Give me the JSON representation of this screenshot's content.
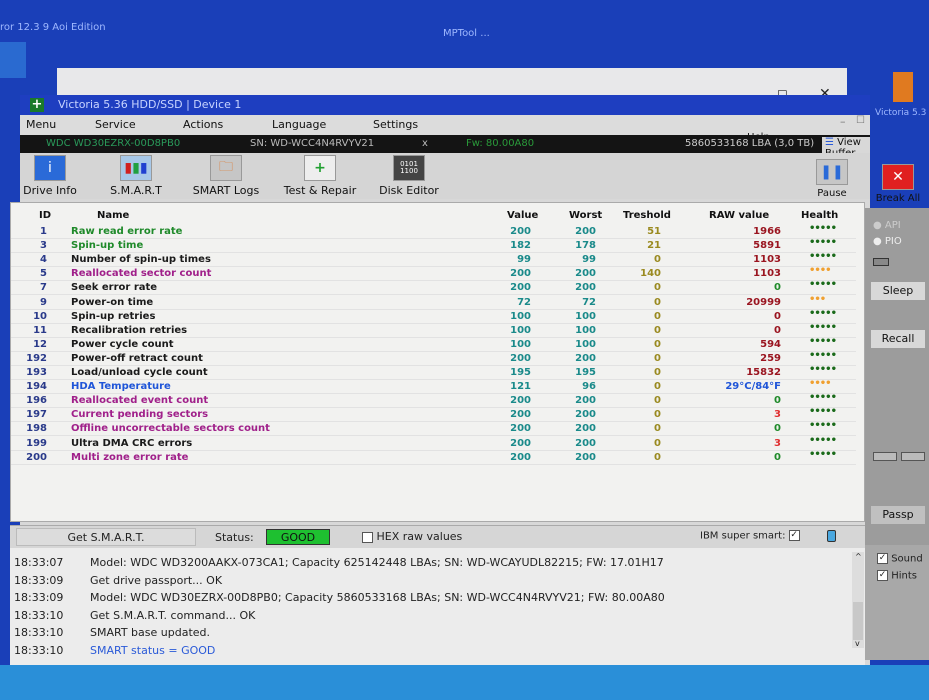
{
  "desktop": {
    "left_text": "ror 12.3  9 Aoi Edition",
    "center_text": "MPTool ...",
    "right_icon_label": "Victoria 5.3"
  },
  "window": {
    "title": "Victoria 5.36 HDD/SSD | Device 1"
  },
  "menu": [
    "Menu",
    "Service",
    "Actions",
    "Language",
    "Settings"
  ],
  "help_label": "Help",
  "view_buffer_label": "View Buffer Live",
  "drive_info": {
    "model": "WDC WD30EZRX-00D8PB0",
    "serial": "SN: WD-WCC4N4RVYV21",
    "close": "x",
    "firmware": "Fw: 80.00A80",
    "capacity": "5860533168 LBA (3,0 TB)"
  },
  "toolbar": [
    {
      "label": "Drive Info",
      "icon": "info-icon"
    },
    {
      "label": "S.M.A.R.T",
      "icon": "smart-icon"
    },
    {
      "label": "SMART Logs",
      "icon": "logs-icon"
    },
    {
      "label": "Test & Repair",
      "icon": "repair-icon"
    },
    {
      "label": "Disk Editor",
      "icon": "disk-editor-icon"
    }
  ],
  "pause_label": "Pause",
  "break_label": "Break All",
  "columns": [
    "ID",
    "Name",
    "Value",
    "Worst",
    "Treshold",
    "RAW value",
    "Health"
  ],
  "colors": {
    "green": "#1f8a2a",
    "purple": "#a0208a",
    "black": "#1a1a1a",
    "blue": "#1f55d8",
    "darkred": "#9a1520",
    "red": "#e03030",
    "teal": "#1a8a8a",
    "olive": "#9a8a20",
    "dotgreen": "#1a6a1a",
    "dotorange": "#f0a030"
  },
  "rows": [
    {
      "id": "1",
      "name": "Raw read error rate",
      "value": "200",
      "worst": "200",
      "threshold": "51",
      "raw": "1966",
      "health": 5,
      "nc": "green",
      "rc": "darkred",
      "hc": "dotgreen"
    },
    {
      "id": "3",
      "name": "Spin-up time",
      "value": "182",
      "worst": "178",
      "threshold": "21",
      "raw": "5891",
      "health": 5,
      "nc": "green",
      "rc": "darkred",
      "hc": "dotgreen"
    },
    {
      "id": "4",
      "name": "Number of spin-up times",
      "value": "99",
      "worst": "99",
      "threshold": "0",
      "raw": "1103",
      "health": 5,
      "nc": "black",
      "rc": "darkred",
      "hc": "dotgreen"
    },
    {
      "id": "5",
      "name": "Reallocated sector count",
      "value": "200",
      "worst": "200",
      "threshold": "140",
      "raw": "1103",
      "health": 4,
      "nc": "purple",
      "rc": "darkred",
      "hc": "dotorange"
    },
    {
      "id": "7",
      "name": "Seek error rate",
      "value": "200",
      "worst": "200",
      "threshold": "0",
      "raw": "0",
      "health": 5,
      "nc": "black",
      "rc": "green",
      "hc": "dotgreen"
    },
    {
      "id": "9",
      "name": "Power-on time",
      "value": "72",
      "worst": "72",
      "threshold": "0",
      "raw": "20999",
      "health": 3,
      "nc": "black",
      "rc": "darkred",
      "hc": "dotorange"
    },
    {
      "id": "10",
      "name": "Spin-up retries",
      "value": "100",
      "worst": "100",
      "threshold": "0",
      "raw": "0",
      "health": 5,
      "nc": "black",
      "rc": "darkred",
      "hc": "dotgreen"
    },
    {
      "id": "11",
      "name": "Recalibration retries",
      "value": "100",
      "worst": "100",
      "threshold": "0",
      "raw": "0",
      "health": 5,
      "nc": "black",
      "rc": "darkred",
      "hc": "dotgreen"
    },
    {
      "id": "12",
      "name": "Power cycle count",
      "value": "100",
      "worst": "100",
      "threshold": "0",
      "raw": "594",
      "health": 5,
      "nc": "black",
      "rc": "darkred",
      "hc": "dotgreen"
    },
    {
      "id": "192",
      "name": "Power-off retract count",
      "value": "200",
      "worst": "200",
      "threshold": "0",
      "raw": "259",
      "health": 5,
      "nc": "black",
      "rc": "darkred",
      "hc": "dotgreen"
    },
    {
      "id": "193",
      "name": "Load/unload cycle count",
      "value": "195",
      "worst": "195",
      "threshold": "0",
      "raw": "15832",
      "health": 5,
      "nc": "black",
      "rc": "darkred",
      "hc": "dotgreen"
    },
    {
      "id": "194",
      "name": "HDA Temperature",
      "value": "121",
      "worst": "96",
      "threshold": "0",
      "raw": "29°C/84°F",
      "health": 4,
      "nc": "blue",
      "rc": "blue",
      "hc": "dotorange"
    },
    {
      "id": "196",
      "name": "Reallocated event count",
      "value": "200",
      "worst": "200",
      "threshold": "0",
      "raw": "0",
      "health": 5,
      "nc": "purple",
      "rc": "green",
      "hc": "dotgreen"
    },
    {
      "id": "197",
      "name": "Current pending sectors",
      "value": "200",
      "worst": "200",
      "threshold": "0",
      "raw": "3",
      "health": 5,
      "nc": "purple",
      "rc": "red",
      "hc": "dotgreen"
    },
    {
      "id": "198",
      "name": "Offline uncorrectable sectors count",
      "value": "200",
      "worst": "200",
      "threshold": "0",
      "raw": "0",
      "health": 5,
      "nc": "purple",
      "rc": "green",
      "hc": "dotgreen"
    },
    {
      "id": "199",
      "name": "Ultra DMA CRC errors",
      "value": "200",
      "worst": "200",
      "threshold": "0",
      "raw": "3",
      "health": 5,
      "nc": "black",
      "rc": "red",
      "hc": "dotgreen"
    },
    {
      "id": "200",
      "name": "Multi zone error rate",
      "value": "200",
      "worst": "200",
      "threshold": "0",
      "raw": "0",
      "health": 5,
      "nc": "purple",
      "rc": "green",
      "hc": "dotgreen"
    }
  ],
  "side": {
    "api": "API",
    "pio": "PIO",
    "sleep": "Sleep",
    "recall": "Recall",
    "passp": "Passp",
    "sound": "Sound",
    "hints": "Hints"
  },
  "status": {
    "get_smart": "Get S.M.A.R.T.",
    "status_label": "Status:",
    "status_value": "GOOD",
    "hex_label": "HEX raw values",
    "ibm_label": "IBM super smart:"
  },
  "log": [
    {
      "time": "18:33:07",
      "msg": "Model: WDC WD3200AAKX-073CA1; Capacity 625142448 LBAs; SN: WD-WCAYUDL82215; FW: 17.01H17"
    },
    {
      "time": "18:33:09",
      "msg": "Get drive passport... OK"
    },
    {
      "time": "18:33:09",
      "msg": "Model: WDC WD30EZRX-00D8PB0; Capacity 5860533168 LBAs; SN: WD-WCC4N4RVYV21; FW: 80.00A80"
    },
    {
      "time": "18:33:10",
      "msg": "Get S.M.A.R.T. command... OK"
    },
    {
      "time": "18:33:10",
      "msg": "SMART base updated."
    },
    {
      "time": "18:33:10",
      "msg": "SMART status = GOOD",
      "blue": true
    }
  ]
}
